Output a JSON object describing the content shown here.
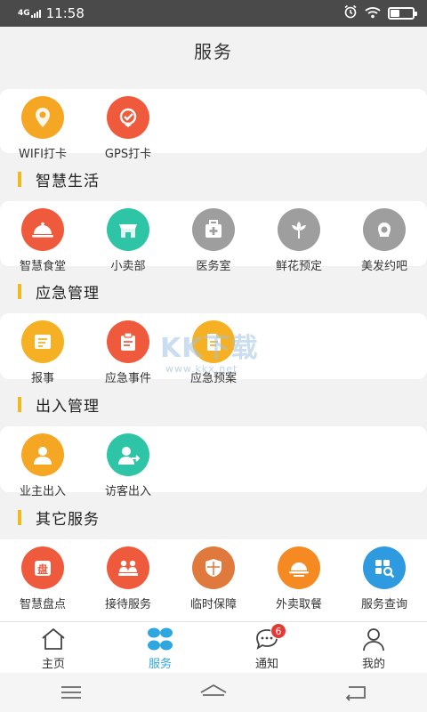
{
  "status_bar": {
    "network": "4G",
    "time": "11:58",
    "icons": [
      "alarm-icon",
      "wifi-icon",
      "battery-icon"
    ]
  },
  "header": {
    "title": "服务"
  },
  "top_items": [
    {
      "label": "WIFI打卡",
      "icon": "wifi-pin-icon",
      "color": "#f5a623"
    },
    {
      "label": "GPS打卡",
      "icon": "gps-check-icon",
      "color": "#f05a3c"
    }
  ],
  "sections": [
    {
      "title": "智慧生活",
      "items": [
        {
          "label": "智慧食堂",
          "icon": "cloche-icon",
          "color": "#f05a3c"
        },
        {
          "label": "小卖部",
          "icon": "shop-icon",
          "color": "#2ec4a6"
        },
        {
          "label": "医务室",
          "icon": "medical-kit-icon",
          "color": "#9e9e9e"
        },
        {
          "label": "鲜花预定",
          "icon": "flower-icon",
          "color": "#9e9e9e"
        },
        {
          "label": "美发约吧",
          "icon": "hairdresser-icon",
          "color": "#9e9e9e"
        }
      ]
    },
    {
      "title": "应急管理",
      "items": [
        {
          "label": "报事",
          "icon": "report-icon",
          "color": "#f5b123"
        },
        {
          "label": "应急事件",
          "icon": "clipboard-icon",
          "color": "#f05a3c"
        },
        {
          "label": "应急预案",
          "icon": "document-icon",
          "color": "#f5b123"
        }
      ]
    },
    {
      "title": "出入管理",
      "items": [
        {
          "label": "业主出入",
          "icon": "owner-icon",
          "color": "#f5a623"
        },
        {
          "label": "访客出入",
          "icon": "visitor-icon",
          "color": "#2ec4a6"
        }
      ]
    },
    {
      "title": "其它服务",
      "items": [
        {
          "label": "智慧盘点",
          "icon": "inventory-icon",
          "color": "#f05a3c"
        },
        {
          "label": "接待服务",
          "icon": "reception-icon",
          "color": "#f05a3c"
        },
        {
          "label": "临时保障",
          "icon": "shield-icon",
          "color": "#e07a3c"
        },
        {
          "label": "外卖取餐",
          "icon": "takeout-icon",
          "color": "#f58a23"
        },
        {
          "label": "服务查询",
          "icon": "search-query-icon",
          "color": "#2e9be0"
        }
      ]
    }
  ],
  "watermark": {
    "main": "KK下载",
    "sub": "www.kkx.net"
  },
  "tab_bar": {
    "tabs": [
      {
        "label": "主页",
        "icon": "home-icon"
      },
      {
        "label": "服务",
        "icon": "services-icon",
        "active": true
      },
      {
        "label": "通知",
        "icon": "message-icon",
        "badge": "6"
      },
      {
        "label": "我的",
        "icon": "user-icon"
      }
    ],
    "active_color": "#2ea7e0",
    "badge_color": "#e53935"
  },
  "system_nav": {
    "buttons": [
      "menu-icon",
      "home-nav-icon",
      "back-icon"
    ]
  }
}
